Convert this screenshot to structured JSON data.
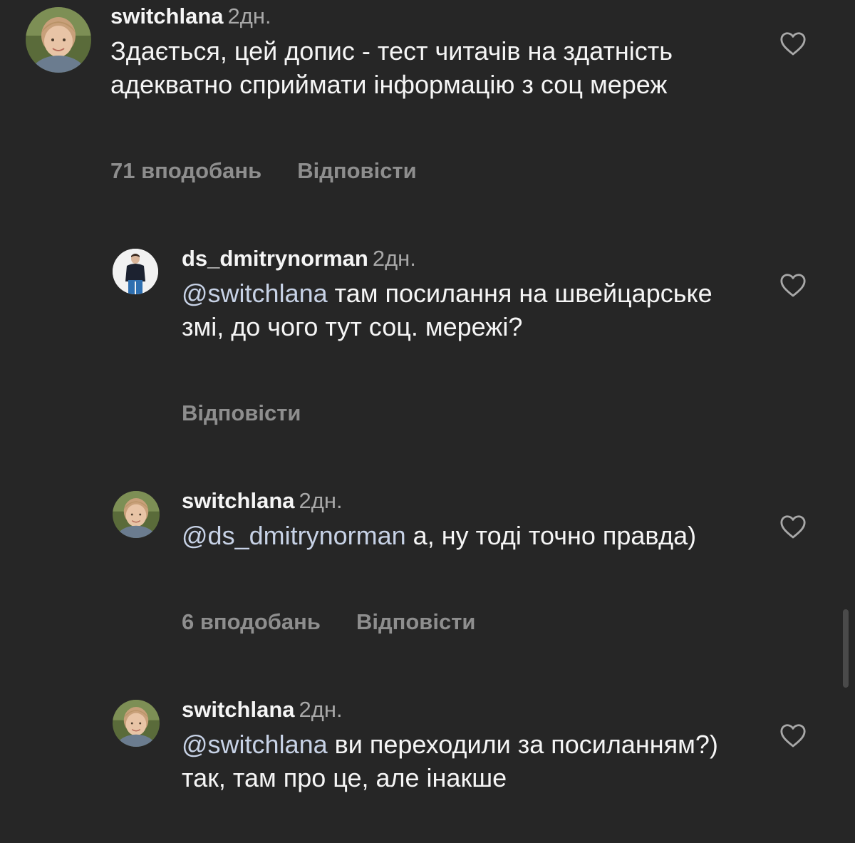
{
  "comments": [
    {
      "username": "switchlana",
      "time": "2дн.",
      "mention": "",
      "text": "Здається, цей допис - тест читачів на здатність адекватно сприймати інформацію з соц мереж",
      "likes": "71 вподобань",
      "reply": "Відповісти"
    },
    {
      "username": "ds_dmitrynorman",
      "time": "2дн.",
      "mention": "@switchlana",
      "text": "там посилання на швейцарське змі, до чого тут соц. мережі?",
      "likes": "",
      "reply": "Відповісти"
    },
    {
      "username": "switchlana",
      "time": "2дн.",
      "mention": "@ds_dmitrynorman",
      "text": "а, ну тоді точно правда)",
      "likes": "6 вподобань",
      "reply": "Відповісти"
    },
    {
      "username": "switchlana",
      "time": "2дн.",
      "mention": "@switchlana",
      "text": "ви переходили за посиланням?) так, там про це, але інакше",
      "likes": "",
      "reply": ""
    }
  ],
  "icons": {
    "like": "heart-outline-icon",
    "avatar_switchlana": "user-photo-woman",
    "avatar_ds_dmitrynorman": "user-photo-man"
  },
  "colors": {
    "background": "#262626",
    "primary_text": "#f5f5f5",
    "secondary_text": "#a8a8a8",
    "action_text": "#8e8e8e",
    "mention": "#c7d2e6"
  }
}
